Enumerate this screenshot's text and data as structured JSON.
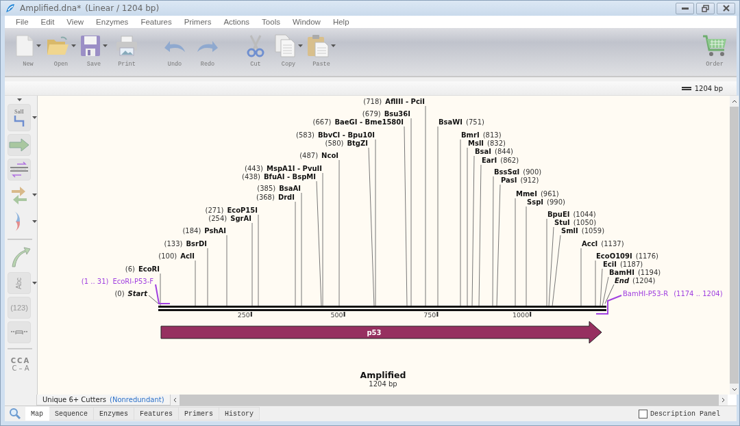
{
  "window": {
    "title": "Amplified.dna*",
    "subtitle": "(Linear / 1204 bp)"
  },
  "menu": [
    "File",
    "Edit",
    "View",
    "Enzymes",
    "Features",
    "Primers",
    "Actions",
    "Tools",
    "Window",
    "Help"
  ],
  "toolbar": [
    {
      "kind": "new",
      "label": "New",
      "has_menu": true
    },
    {
      "kind": "open",
      "label": "Open",
      "has_menu": true
    },
    {
      "kind": "save",
      "label": "Save",
      "has_menu": true
    },
    {
      "kind": "print",
      "label": "Print",
      "has_menu": false
    },
    {
      "kind": "undo",
      "label": "Undo",
      "has_menu": false
    },
    {
      "kind": "redo",
      "label": "Redo",
      "has_menu": false
    },
    {
      "kind": "cut",
      "label": "Cut",
      "has_menu": false
    },
    {
      "kind": "copy",
      "label": "Copy",
      "has_menu": true
    },
    {
      "kind": "paste",
      "label": "Paste",
      "has_menu": true
    },
    {
      "kind": "order",
      "label": "Order",
      "has_menu": false
    }
  ],
  "scale_label": "1204 bp",
  "side_tools": [
    {
      "kind": "enzyme",
      "label": "SalI",
      "has_menu": true
    },
    {
      "kind": "feature",
      "has_menu": false
    },
    {
      "kind": "primer",
      "has_menu": false
    },
    {
      "kind": "orf",
      "has_menu": true
    },
    {
      "kind": "arc",
      "has_menu": true
    },
    {
      "kind": "curve",
      "has_menu": false
    },
    {
      "kind": "text",
      "label": "Abc",
      "has_menu": true
    },
    {
      "kind": "number",
      "label": "(123)",
      "has_menu": false
    },
    {
      "kind": "ruler",
      "has_menu": false
    },
    {
      "kind": "alignment",
      "label": "CCA",
      "label2": "C – A",
      "has_menu": false
    }
  ],
  "map": {
    "enzymes": [
      {
        "kind": "site",
        "position": "(718)",
        "name": "AflIII - PciI"
      },
      {
        "kind": "site",
        "position": "(679)",
        "name": "Bsu36I"
      },
      {
        "kind": "site",
        "position": "(667)",
        "name": "BaeGI - Bme1580I"
      },
      {
        "kind": "site",
        "position": "(583)",
        "name": "BbvCI - Bpu10I"
      },
      {
        "kind": "site",
        "position": "(580)",
        "name": "BtgZI"
      },
      {
        "kind": "site",
        "position": "(487)",
        "name": "NcoI"
      },
      {
        "kind": "site",
        "position": "(443)",
        "name": "MspA1I - PvuII"
      },
      {
        "kind": "site",
        "position": "(438)",
        "name": "BfuAI - BspMI"
      },
      {
        "kind": "site",
        "position": "(385)",
        "name": "BsaAI"
      },
      {
        "kind": "site",
        "position": "(368)",
        "name": "DrdI"
      },
      {
        "kind": "site",
        "position": "(271)",
        "name": "EcoP15I"
      },
      {
        "kind": "site",
        "position": "(254)",
        "name": "SgrAI"
      },
      {
        "kind": "site",
        "position": "(184)",
        "name": "PshAI"
      },
      {
        "kind": "site",
        "position": "(133)",
        "name": "BsrDI"
      },
      {
        "kind": "site",
        "position": "(100)",
        "name": "AclI"
      },
      {
        "kind": "site",
        "position": "(6)",
        "name": "EcoRI"
      },
      {
        "kind": "terminus",
        "position": "(0)",
        "name": "Start"
      },
      {
        "kind": "site",
        "position": "(751)",
        "name": "BsaWI"
      },
      {
        "kind": "site",
        "position": "(813)",
        "name": "BmrI"
      },
      {
        "kind": "site",
        "position": "(832)",
        "name": "MslI"
      },
      {
        "kind": "site",
        "position": "(844)",
        "name": "BsaI"
      },
      {
        "kind": "site",
        "position": "(862)",
        "name": "EarI"
      },
      {
        "kind": "site",
        "position": "(900)",
        "name": "BssSαI"
      },
      {
        "kind": "site",
        "position": "(912)",
        "name": "PasI"
      },
      {
        "kind": "site",
        "position": "(961)",
        "name": "MmeI"
      },
      {
        "kind": "site",
        "position": "(990)",
        "name": "SspI"
      },
      {
        "kind": "site",
        "position": "(1044)",
        "name": "BpuEI"
      },
      {
        "kind": "site",
        "position": "(1050)",
        "name": "StuI"
      },
      {
        "kind": "site",
        "position": "(1059)",
        "name": "SmlI"
      },
      {
        "kind": "site",
        "position": "(1137)",
        "name": "AccI"
      },
      {
        "kind": "site",
        "position": "(1176)",
        "name": "EcoO109I"
      },
      {
        "kind": "site",
        "position": "(1187)",
        "name": "EciI"
      },
      {
        "kind": "site",
        "position": "(1194)",
        "name": "BamHI"
      },
      {
        "kind": "terminus",
        "position": "(1204)",
        "name": "End"
      }
    ],
    "primers": [
      {
        "kind": "forward",
        "range": "(1 .. 31)",
        "name": "EcoRI-P53-F"
      },
      {
        "kind": "reverse",
        "name": "BamHI-P53-R",
        "range": "(1174 .. 1204)"
      }
    ],
    "ticks": [
      "250",
      "500",
      "750",
      "1000"
    ],
    "feature": {
      "label": "p53",
      "color": "#963060"
    },
    "title": "Amplified",
    "length": "1204 bp"
  },
  "enzyme_set": {
    "name": "Unique 6+ Cutters",
    "qualifier": "(Nonredundant)"
  },
  "tabs": [
    {
      "label": "Map",
      "selected": true
    },
    {
      "label": "Sequence",
      "selected": false
    },
    {
      "label": "Enzymes",
      "selected": false
    },
    {
      "label": "Features",
      "selected": false
    },
    {
      "label": "Primers",
      "selected": false
    },
    {
      "label": "History",
      "selected": false
    }
  ],
  "description_panel": {
    "label": "Description Panel",
    "checked": false
  }
}
